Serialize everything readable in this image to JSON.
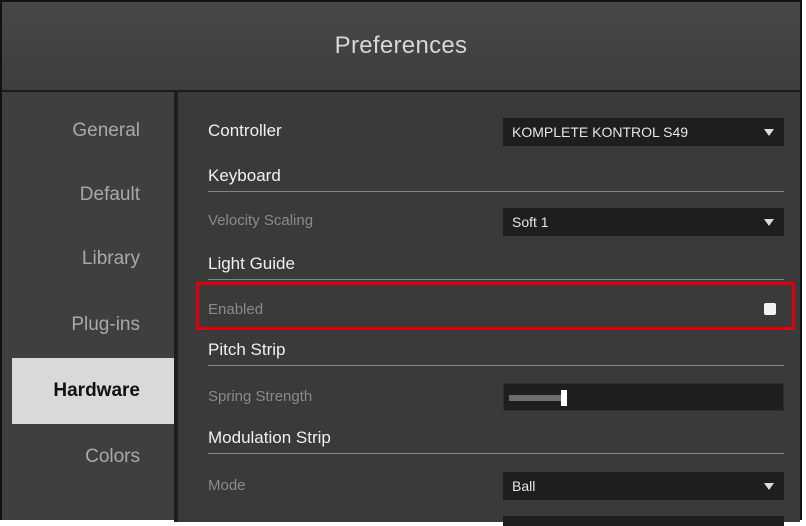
{
  "window": {
    "title": "Preferences"
  },
  "sidebar": {
    "items": [
      {
        "label": "General",
        "active": false
      },
      {
        "label": "Default",
        "active": false
      },
      {
        "label": "Library",
        "active": false
      },
      {
        "label": "Plug-ins",
        "active": false
      },
      {
        "label": "Hardware",
        "active": true
      },
      {
        "label": "Colors",
        "active": false
      }
    ]
  },
  "main": {
    "controller": {
      "label": "Controller",
      "value": "KOMPLETE KONTROL S49"
    },
    "keyboard": {
      "section": "Keyboard",
      "velocity_scaling": {
        "label": "Velocity Scaling",
        "value": "Soft 1"
      }
    },
    "light_guide": {
      "section": "Light Guide",
      "enabled": {
        "label": "Enabled",
        "checked": true
      }
    },
    "pitch_strip": {
      "section": "Pitch Strip",
      "spring_strength": {
        "label": "Spring Strength",
        "level_fraction": 0.16
      }
    },
    "modulation_strip": {
      "section": "Modulation Strip",
      "mode": {
        "label": "Mode",
        "value": "Ball"
      }
    }
  },
  "colors": {
    "highlight": "#e0000b",
    "active_nav_bg": "#d9d9d9",
    "panel_bg": "#3a3a3a",
    "control_bg": "#1e1e1e"
  }
}
